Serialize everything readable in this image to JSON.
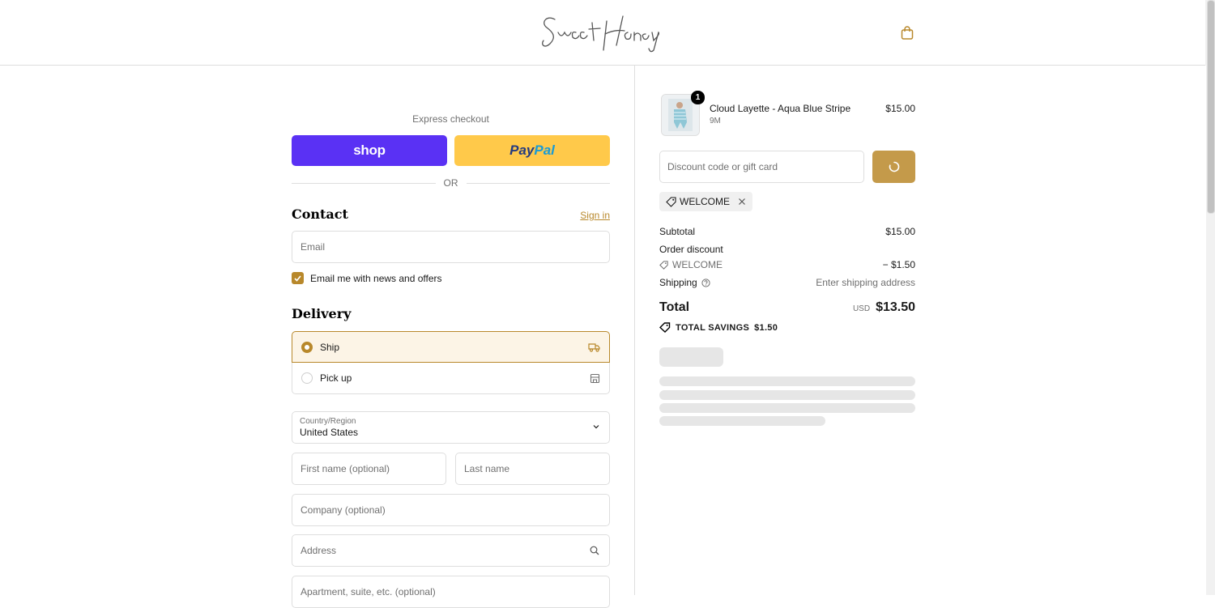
{
  "header": {
    "logo_text": "SweetHoney",
    "cart_icon": "shopping-bag-icon"
  },
  "express": {
    "title": "Express checkout",
    "shop_label": "shop",
    "paypal_pay": "Pay",
    "paypal_pal": "Pal",
    "or_label": "OR"
  },
  "contact": {
    "title": "Contact",
    "signin": "Sign in",
    "email_placeholder": "Email",
    "newsletter_label": "Email me with news and offers",
    "newsletter_checked": true
  },
  "delivery": {
    "title": "Delivery",
    "options": [
      {
        "label": "Ship",
        "selected": true,
        "icon": "truck-icon"
      },
      {
        "label": "Pick up",
        "selected": false,
        "icon": "store-icon"
      }
    ],
    "country_label": "Country/Region",
    "country_value": "United States",
    "first_name_placeholder": "First name (optional)",
    "last_name_placeholder": "Last name",
    "company_placeholder": "Company (optional)",
    "address_placeholder": "Address",
    "apartment_placeholder": "Apartment, suite, etc. (optional)"
  },
  "order": {
    "item": {
      "name": "Cloud Layette - Aqua Blue Stripe",
      "variant": "9M",
      "price": "$15.00",
      "quantity": "1"
    },
    "discount_placeholder": "Discount code or gift card",
    "applied_code": "WELCOME",
    "subtotal_label": "Subtotal",
    "subtotal_value": "$15.00",
    "order_discount_label": "Order discount",
    "discount_code": "WELCOME",
    "discount_value": "− $1.50",
    "shipping_label": "Shipping",
    "shipping_value": "Enter shipping address",
    "total_label": "Total",
    "currency": "USD",
    "total_value": "$13.50",
    "savings_label": "TOTAL SAVINGS",
    "savings_value": "$1.50"
  },
  "colors": {
    "accent": "#b8882b",
    "shop_purple": "#5a31f4",
    "paypal_yellow": "#ffc94a"
  }
}
